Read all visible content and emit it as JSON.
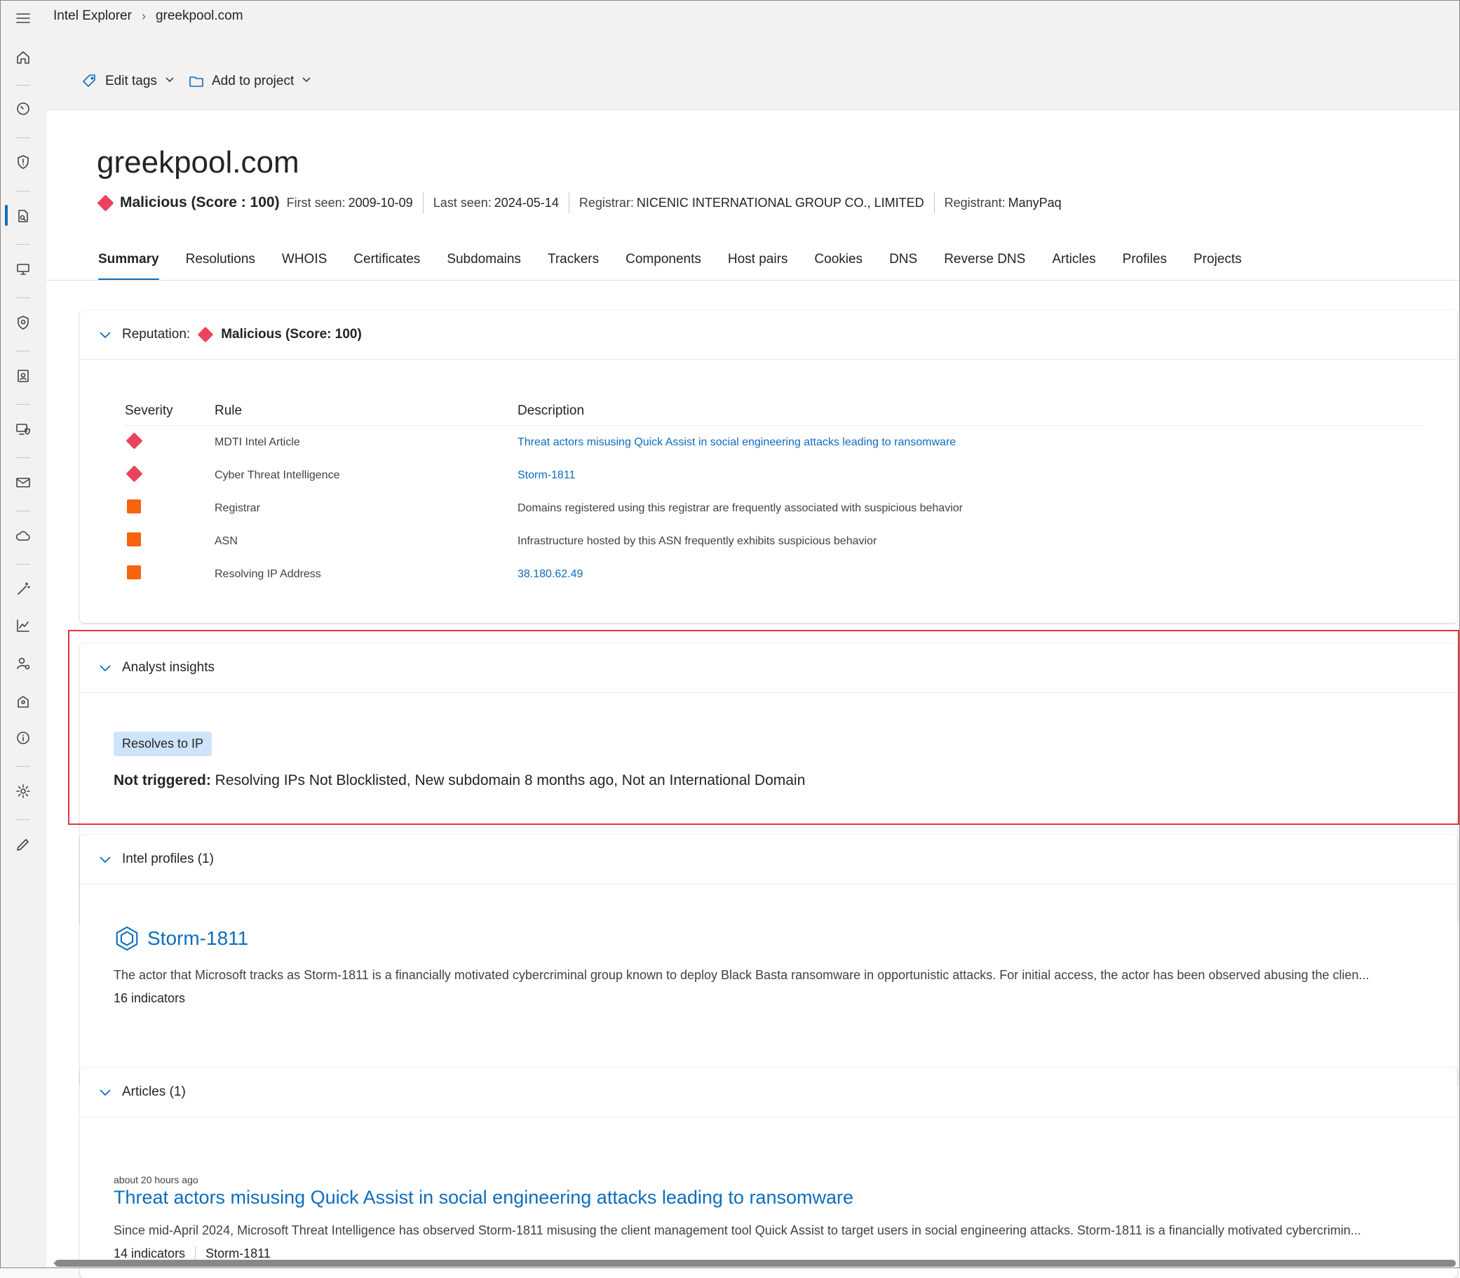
{
  "breadcrumb": {
    "root": "Intel Explorer",
    "current": "greekpool.com"
  },
  "commands": {
    "edit_tags": "Edit tags",
    "add_to_project": "Add to project"
  },
  "header": {
    "title": "greekpool.com",
    "verdict": "Malicious (Score : 100)",
    "first_seen_label": "First seen:",
    "first_seen": "2009-10-09",
    "last_seen_label": "Last seen:",
    "last_seen": "2024-05-14",
    "registrar_label": "Registrar:",
    "registrar": "NICENIC INTERNATIONAL GROUP CO., LIMITED",
    "registrant_label": "Registrant:",
    "registrant": "ManyPaq"
  },
  "tabs": [
    "Summary",
    "Resolutions",
    "WHOIS",
    "Certificates",
    "Subdomains",
    "Trackers",
    "Components",
    "Host pairs",
    "Cookies",
    "DNS",
    "Reverse DNS",
    "Articles",
    "Profiles",
    "Projects"
  ],
  "reputation": {
    "label": "Reputation:",
    "verdict": "Malicious (Score: 100)",
    "columns": [
      "Severity",
      "Rule",
      "Description"
    ],
    "rows": [
      {
        "severity": "high",
        "rule": "MDTI Intel Article",
        "description": "Threat actors misusing Quick Assist in social engineering attacks leading to ransomware",
        "is_link": true
      },
      {
        "severity": "high",
        "rule": "Cyber Threat Intelligence",
        "description": "Storm-1811",
        "is_link": true
      },
      {
        "severity": "medium",
        "rule": "Registrar",
        "description": "Domains registered using this registrar are frequently associated with suspicious behavior",
        "is_link": false
      },
      {
        "severity": "medium",
        "rule": "ASN",
        "description": "Infrastructure hosted by this ASN frequently exhibits suspicious behavior",
        "is_link": false
      },
      {
        "severity": "medium",
        "rule": "Resolving IP Address",
        "description": "38.180.62.49",
        "is_link": true
      }
    ]
  },
  "analyst": {
    "title": "Analyst insights",
    "tag": "Resolves to IP",
    "not_triggered_label": "Not triggered:",
    "not_triggered": "Resolving IPs Not Blocklisted, New subdomain 8 months ago, Not an International Domain"
  },
  "profiles": {
    "title": "Intel profiles (1)",
    "name": "Storm-1811",
    "description": "The actor that Microsoft tracks as Storm-1811 is a financially motivated cybercriminal group known to deploy Black Basta ransomware in opportunistic attacks. For initial access, the actor has been observed abusing the clien...",
    "indicators": "16 indicators"
  },
  "articles": {
    "title": "Articles (1)",
    "time": "about 20 hours ago",
    "headline": "Threat actors misusing Quick Assist in social engineering attacks leading to ransomware",
    "description": "Since mid-April 2024, Microsoft Threat Intelligence has observed Storm-1811 misusing the client management tool Quick Assist to target users in social engineering attacks. Storm-1811 is a financially motivated cybercrimin...",
    "indicators": "14 indicators",
    "actor": "Storm-1811"
  },
  "colors": {
    "accent": "#0f6cbd",
    "malicious": "#e9435d",
    "suspicious": "#f7630c",
    "highlight": "#e3343f"
  }
}
